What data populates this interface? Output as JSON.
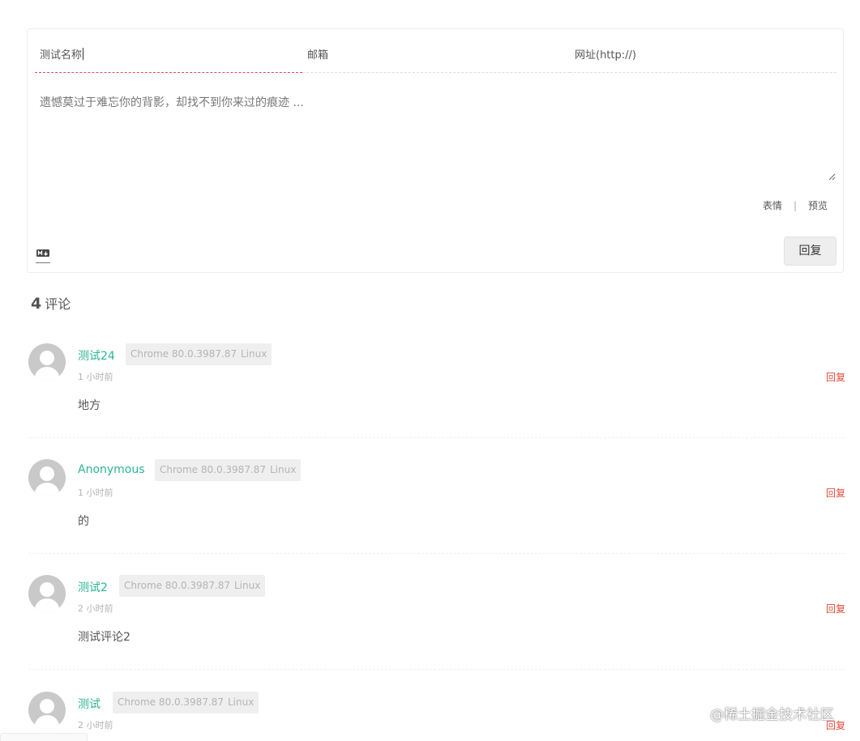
{
  "form": {
    "name_value": "测试名称",
    "email_placeholder": "邮箱",
    "url_placeholder": "网址(http://)",
    "textarea_placeholder": "遗憾莫过于难忘你的背影，却找不到你来过的痕迹 ...",
    "emoji_label": "表情",
    "separator": "|",
    "preview_label": "预览",
    "markdown_icon": "markdown-icon",
    "submit_label": "回复"
  },
  "count": {
    "number": "4",
    "label": "评论"
  },
  "comments": [
    {
      "nick": "测试24",
      "browser": "Chrome 80.0.3987.87",
      "os": "Linux",
      "time": "1 小时前",
      "reply": "回复",
      "content": "地方"
    },
    {
      "nick": "Anonymous",
      "browser": "Chrome 80.0.3987.87",
      "os": "Linux",
      "time": "1 小时前",
      "reply": "回复",
      "content": "的"
    },
    {
      "nick": "测试2",
      "browser": "Chrome 80.0.3987.87",
      "os": "Linux",
      "time": "2 小时前",
      "reply": "回复",
      "content": "测试评论2"
    },
    {
      "nick": "测试",
      "browser": "Chrome 80.0.3987.87",
      "os": "Linux",
      "time": "2 小时前",
      "reply": "回复",
      "content": ""
    }
  ],
  "watermark": "@稀土掘金技术社区",
  "colors": {
    "nick": "#2bb596",
    "reply": "#e24a3a",
    "active_underline": "#e24a5a"
  }
}
